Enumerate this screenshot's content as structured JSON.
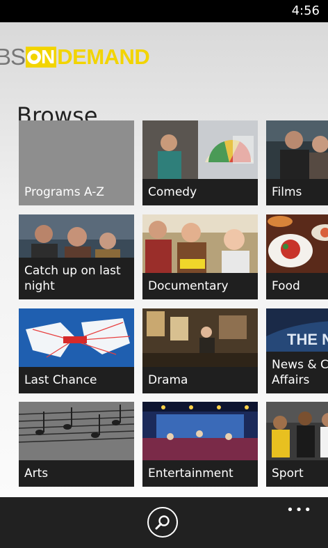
{
  "status_bar": {
    "time": "4:56"
  },
  "logo": {
    "prefix": "BS",
    "on_letter": "N",
    "suffix": "DEMAND"
  },
  "page": {
    "title": "Browse"
  },
  "tiles": [
    {
      "label": "Programs A-Z"
    },
    {
      "label": "Comedy"
    },
    {
      "label": "Films"
    },
    {
      "label": "Catch up on last night"
    },
    {
      "label": "Documentary"
    },
    {
      "label": "Food"
    },
    {
      "label": "Last Chance"
    },
    {
      "label": "Drama"
    },
    {
      "label": "News & Current Affairs"
    },
    {
      "label": "Arts"
    },
    {
      "label": "Entertainment"
    },
    {
      "label": "Sport"
    }
  ],
  "app_bar": {
    "search_icon": "search-icon",
    "more_label": "•••"
  },
  "colors": {
    "brand_yellow": "#f2d400",
    "tile_caption": "#1f1f1f"
  }
}
